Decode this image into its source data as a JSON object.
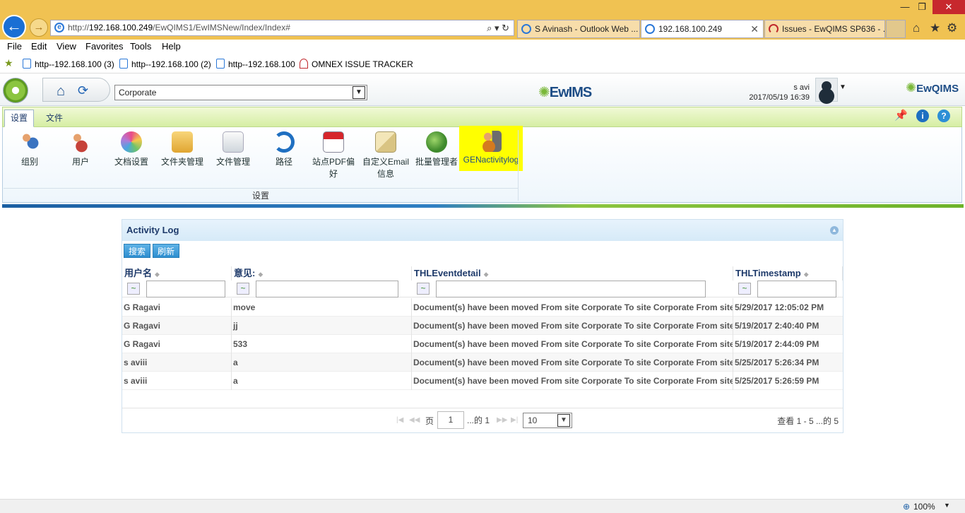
{
  "browser": {
    "url_prefix": "http://",
    "url_host": "192.168.100.249",
    "url_path": "/EwQIMS1/EwIMSNew/Index/Index#",
    "tabs": [
      {
        "label": "S Avinash - Outlook Web ..."
      },
      {
        "label": "192.168.100.249"
      },
      {
        "label": "Issues - EwQIMS SP636 - ..."
      }
    ],
    "menu": [
      "File",
      "Edit",
      "View",
      "Favorites",
      "Tools",
      "Help"
    ],
    "favorites": [
      "http--192.168.100 (3)",
      "http--192.168.100 (2)",
      "http--192.168.100",
      "OMNEX ISSUE TRACKER"
    ],
    "zoom": "100%"
  },
  "app": {
    "site": "Corporate",
    "logo_main": "EwIMS",
    "logo_right": "EwQIMS",
    "user_name": "s avi",
    "user_datetime": "2017/05/19 16:39"
  },
  "ribbon": {
    "tabs": [
      "设置",
      "文件"
    ],
    "buttons": [
      "组别",
      "用户",
      "文档设置",
      "文件夹管理",
      "文件管理",
      "路径",
      "站点PDF偏好",
      "自定义Email信息",
      "批量管理者",
      "GENactivitylog"
    ],
    "group_label": "设置",
    "colors": {
      "highlight": "#ffff00",
      "accent": "#8cc540"
    }
  },
  "panel": {
    "title": "Activity Log",
    "search_label": "搜索",
    "refresh_label": "刷新",
    "columns": [
      "用户名",
      "意见:",
      "THLEventdetail",
      "THLTimestamp"
    ],
    "rows": [
      [
        "G Ragavi",
        "move",
        "Document(s) have been moved From site Corporate To site Corporate From site le",
        "5/29/2017 12:05:02 PM"
      ],
      [
        "G Ragavi",
        "jj",
        "Document(s) have been moved From site Corporate To site Corporate From site le",
        "5/19/2017 2:40:40 PM"
      ],
      [
        "G Ragavi",
        "533",
        "Document(s) have been moved From site Corporate To site Corporate From site le",
        "5/19/2017 2:44:09 PM"
      ],
      [
        "s aviii",
        "a",
        "Document(s) have been moved From site Corporate To site Corporate From site le",
        "5/25/2017 5:26:34 PM"
      ],
      [
        "s aviii",
        "a",
        "Document(s) have been moved From site Corporate To site Corporate From site le",
        "5/25/2017 5:26:59 PM"
      ]
    ],
    "pager": {
      "page_label": "页",
      "page": "1",
      "of_label": "...的 1",
      "page_size": "10",
      "summary": "查看 1 - 5 ...的 5"
    }
  }
}
